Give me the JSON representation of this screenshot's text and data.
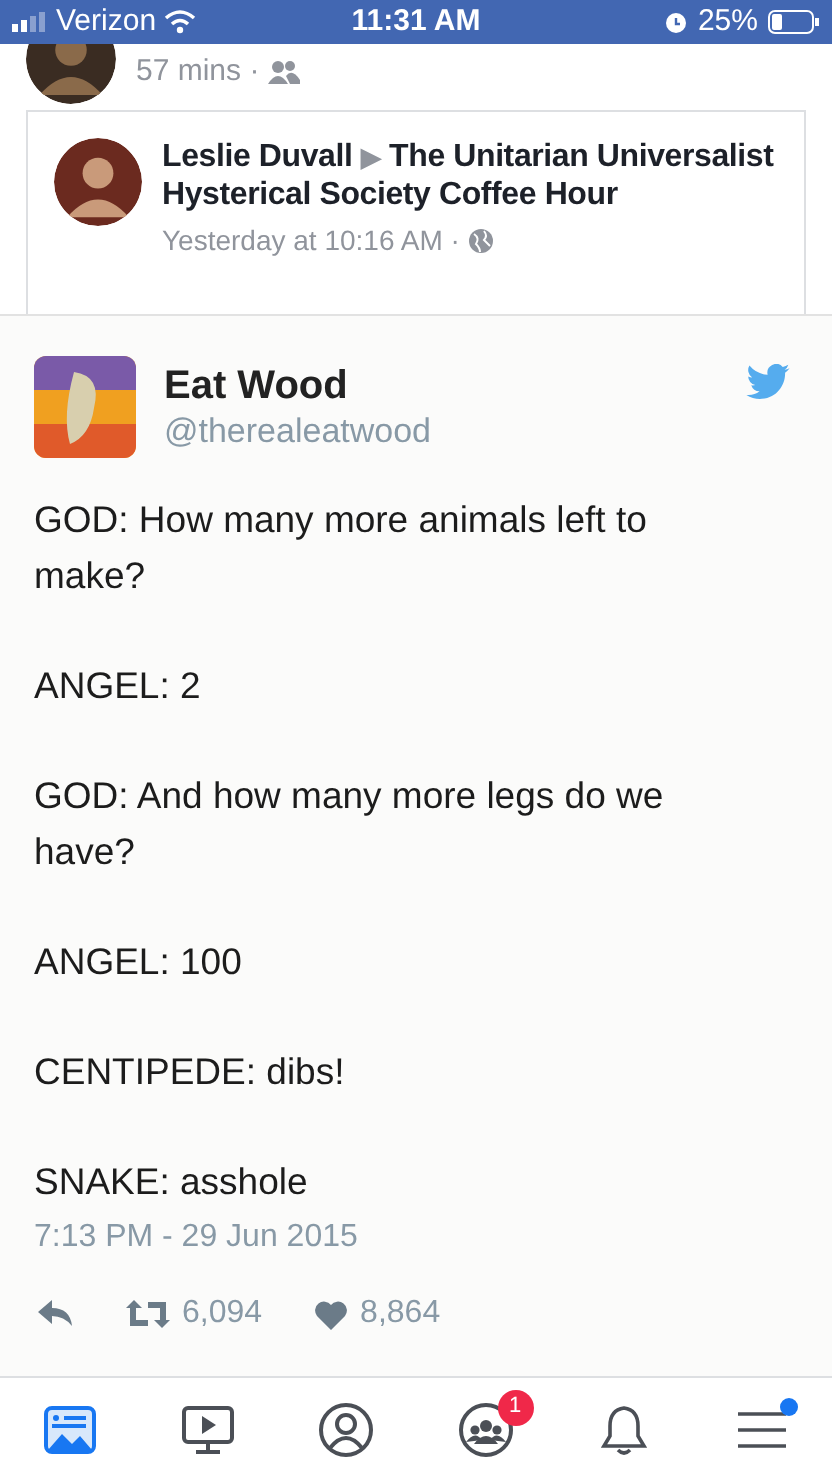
{
  "status_bar": {
    "carrier": "Verizon",
    "time": "11:31 AM",
    "battery": "25%"
  },
  "previous_post": {
    "meta": "57 mins ·"
  },
  "shared_post": {
    "author": "Leslie Duvall",
    "separator": "▶",
    "group": "The Unitarian Universalist Hysterical Society Coffee Hour",
    "time": "Yesterday at 10:16 AM ·"
  },
  "tweet": {
    "name": "Eat Wood",
    "handle": "@therealeatwood",
    "paragraphs": [
      "GOD: How many more animals left to make?",
      "ANGEL: 2",
      "GOD: And how many more legs do we have?",
      "ANGEL: 100",
      "CENTIPEDE: dibs!",
      "SNAKE: asshole"
    ],
    "timestamp": "7:13 PM - 29 Jun 2015",
    "retweets": "6,094",
    "likes": "8,864"
  },
  "tab_bar": [
    {
      "kind": "feed",
      "selected": true
    },
    {
      "kind": "watch",
      "selected": false
    },
    {
      "kind": "profile",
      "selected": false
    },
    {
      "kind": "groups",
      "selected": false,
      "badge": "1"
    },
    {
      "kind": "notifications",
      "selected": false
    },
    {
      "kind": "menu",
      "selected": false,
      "dot": true
    }
  ]
}
